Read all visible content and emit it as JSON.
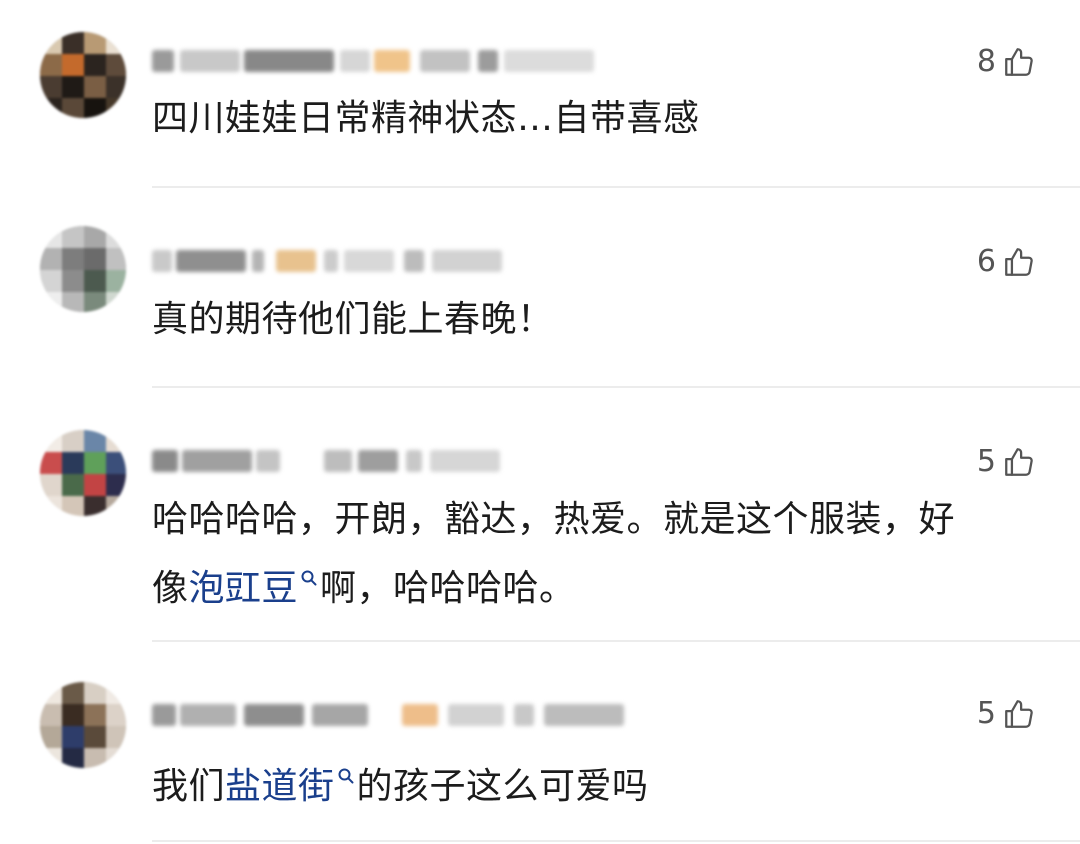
{
  "comments": [
    {
      "likes": "8",
      "text": "四川娃娃日常精神状态…自带喜感",
      "segments": []
    },
    {
      "likes": "6",
      "text": "真的期待他们能上春晚！"
    },
    {
      "likes": "5",
      "line1": "哈哈哈哈，开朗，豁达，热爱。就是这个服装，好",
      "line2_prefix": "像",
      "topic": "泡豇豆",
      "line2_suffix": "啊，哈哈哈哈。"
    },
    {
      "likes": "5",
      "prefix": "我们",
      "topic": "盐道街",
      "suffix": "的孩子这么可爱吗"
    }
  ],
  "icons": {
    "like": "thumbs-up-icon",
    "topic_search": "search-icon"
  },
  "colors": {
    "topic_link": "#1a3f8c",
    "text": "#1c1c1c",
    "count": "#555555",
    "divider": "#ececec"
  }
}
